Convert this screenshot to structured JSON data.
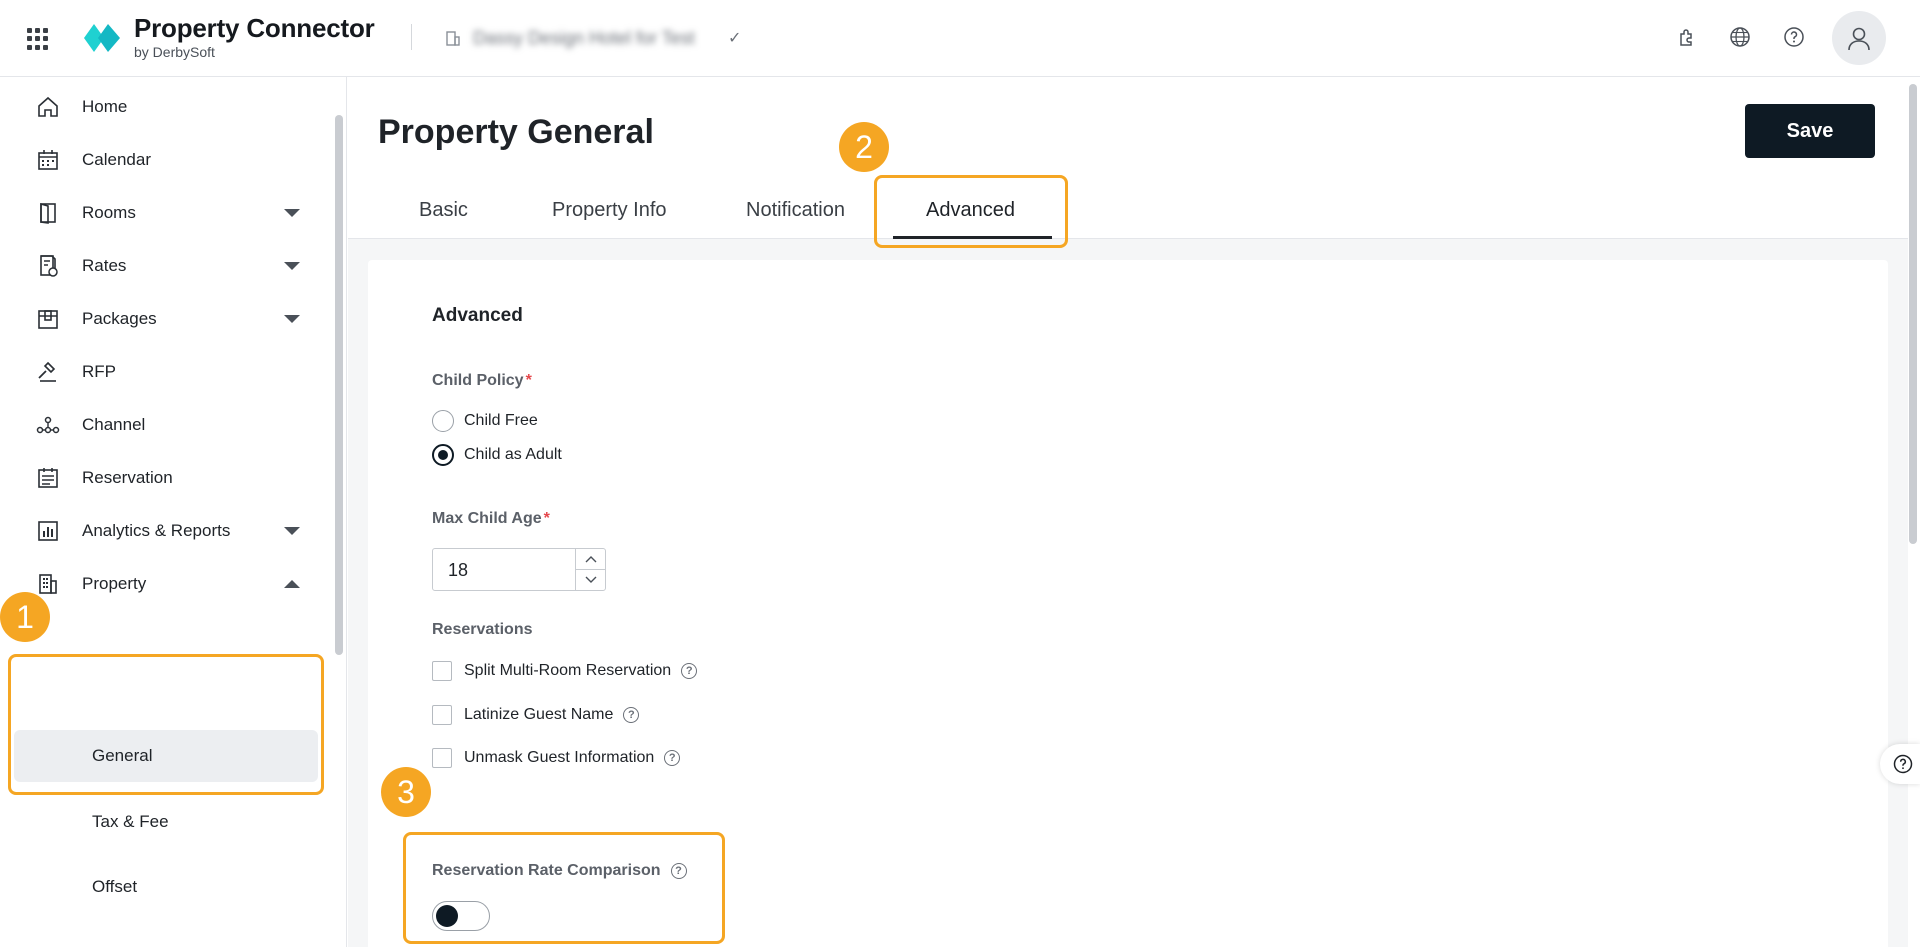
{
  "header": {
    "brand_name": "Property Connector",
    "brand_sub": "by DerbySoft",
    "hotel_name": "Dassy Design Hotel for Test",
    "hotel_check": "✓"
  },
  "sidebar": {
    "items": [
      {
        "label": "Home",
        "icon": "home-icon"
      },
      {
        "label": "Calendar",
        "icon": "calendar-icon"
      },
      {
        "label": "Rooms",
        "icon": "door-icon"
      },
      {
        "label": "Rates",
        "icon": "rates-icon"
      },
      {
        "label": "Packages",
        "icon": "package-icon"
      },
      {
        "label": "RFP",
        "icon": "gavel-icon"
      },
      {
        "label": "Channel",
        "icon": "channel-icon"
      },
      {
        "label": "Reservation",
        "icon": "reservation-icon"
      },
      {
        "label": "Analytics & Reports",
        "icon": "analytics-icon"
      },
      {
        "label": "Property",
        "icon": "building-icon"
      }
    ],
    "sub_items": [
      "General",
      "Tax & Fee",
      "Offset"
    ]
  },
  "main": {
    "title": "Property General",
    "save_label": "Save",
    "tabs": [
      "Basic",
      "Property Info",
      "Notification",
      "Advanced"
    ],
    "active_tab": "Advanced",
    "section_title": "Advanced",
    "child_policy": {
      "label": "Child Policy",
      "required_mark": "*",
      "options": [
        "Child Free",
        "Child as Adult"
      ],
      "selected": "Child as Adult"
    },
    "max_child_age": {
      "label": "Max Child Age",
      "required_mark": "*",
      "value": "18"
    },
    "reservations": {
      "label": "Reservations",
      "options": [
        {
          "label": "Split Multi-Room Reservation",
          "checked": false
        },
        {
          "label": "Latinize Guest Name",
          "checked": false
        },
        {
          "label": "Unmask Guest Information",
          "checked": false
        }
      ]
    },
    "rate_comparison": {
      "label": "Reservation Rate Comparison",
      "enabled": false
    }
  },
  "annotations": [
    "1",
    "2",
    "3"
  ],
  "colors": {
    "accent": "#f5a623",
    "primary_button": "#0e1a24",
    "logo_cyan": "#1fd1d1",
    "required": "#e5484d"
  }
}
